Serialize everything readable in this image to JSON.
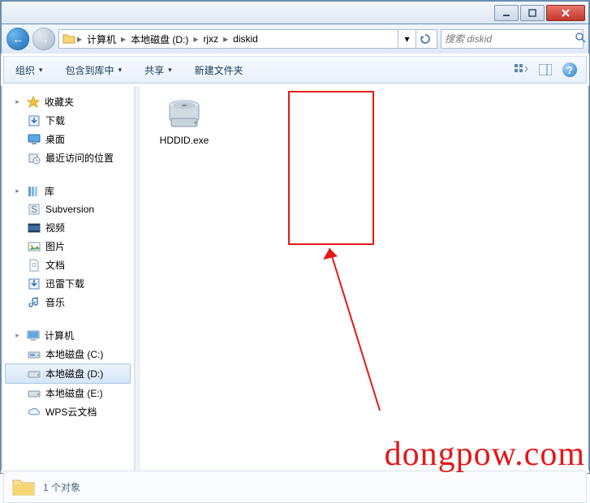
{
  "breadcrumbs": {
    "root_icon": "computer-icon",
    "items": [
      "计算机",
      "本地磁盘 (D:)",
      "rjxz",
      "diskid"
    ]
  },
  "search": {
    "placeholder": "搜索 diskid"
  },
  "toolbar": {
    "organize": "组织",
    "include": "包含到库中",
    "share": "共享",
    "new_folder": "新建文件夹"
  },
  "tree": {
    "favorites": {
      "label": "收藏夹",
      "children": [
        {
          "icon": "download-icon",
          "label": "下载"
        },
        {
          "icon": "desktop-icon",
          "label": "桌面"
        },
        {
          "icon": "recent-icon",
          "label": "最近访问的位置"
        }
      ]
    },
    "libraries": {
      "label": "库",
      "children": [
        {
          "icon": "svn-icon",
          "label": "Subversion"
        },
        {
          "icon": "video-icon",
          "label": "视频"
        },
        {
          "icon": "pictures-icon",
          "label": "图片"
        },
        {
          "icon": "documents-icon",
          "label": "文档"
        },
        {
          "icon": "xunlei-icon",
          "label": "迅雷下载"
        },
        {
          "icon": "music-icon",
          "label": "音乐"
        }
      ]
    },
    "computer": {
      "label": "计算机",
      "children": [
        {
          "icon": "drive-c-icon",
          "label": "本地磁盘 (C:)",
          "selected": false
        },
        {
          "icon": "drive-d-icon",
          "label": "本地磁盘 (D:)",
          "selected": true
        },
        {
          "icon": "drive-e-icon",
          "label": "本地磁盘 (E:)",
          "selected": false
        },
        {
          "icon": "cloud-icon",
          "label": "WPS云文档",
          "selected": false
        }
      ]
    }
  },
  "files": [
    {
      "name": "HDDID.exe",
      "icon": "hdd-exe-icon"
    }
  ],
  "status": {
    "count_label": "1 个对象"
  },
  "watermark": "dongpow.com"
}
